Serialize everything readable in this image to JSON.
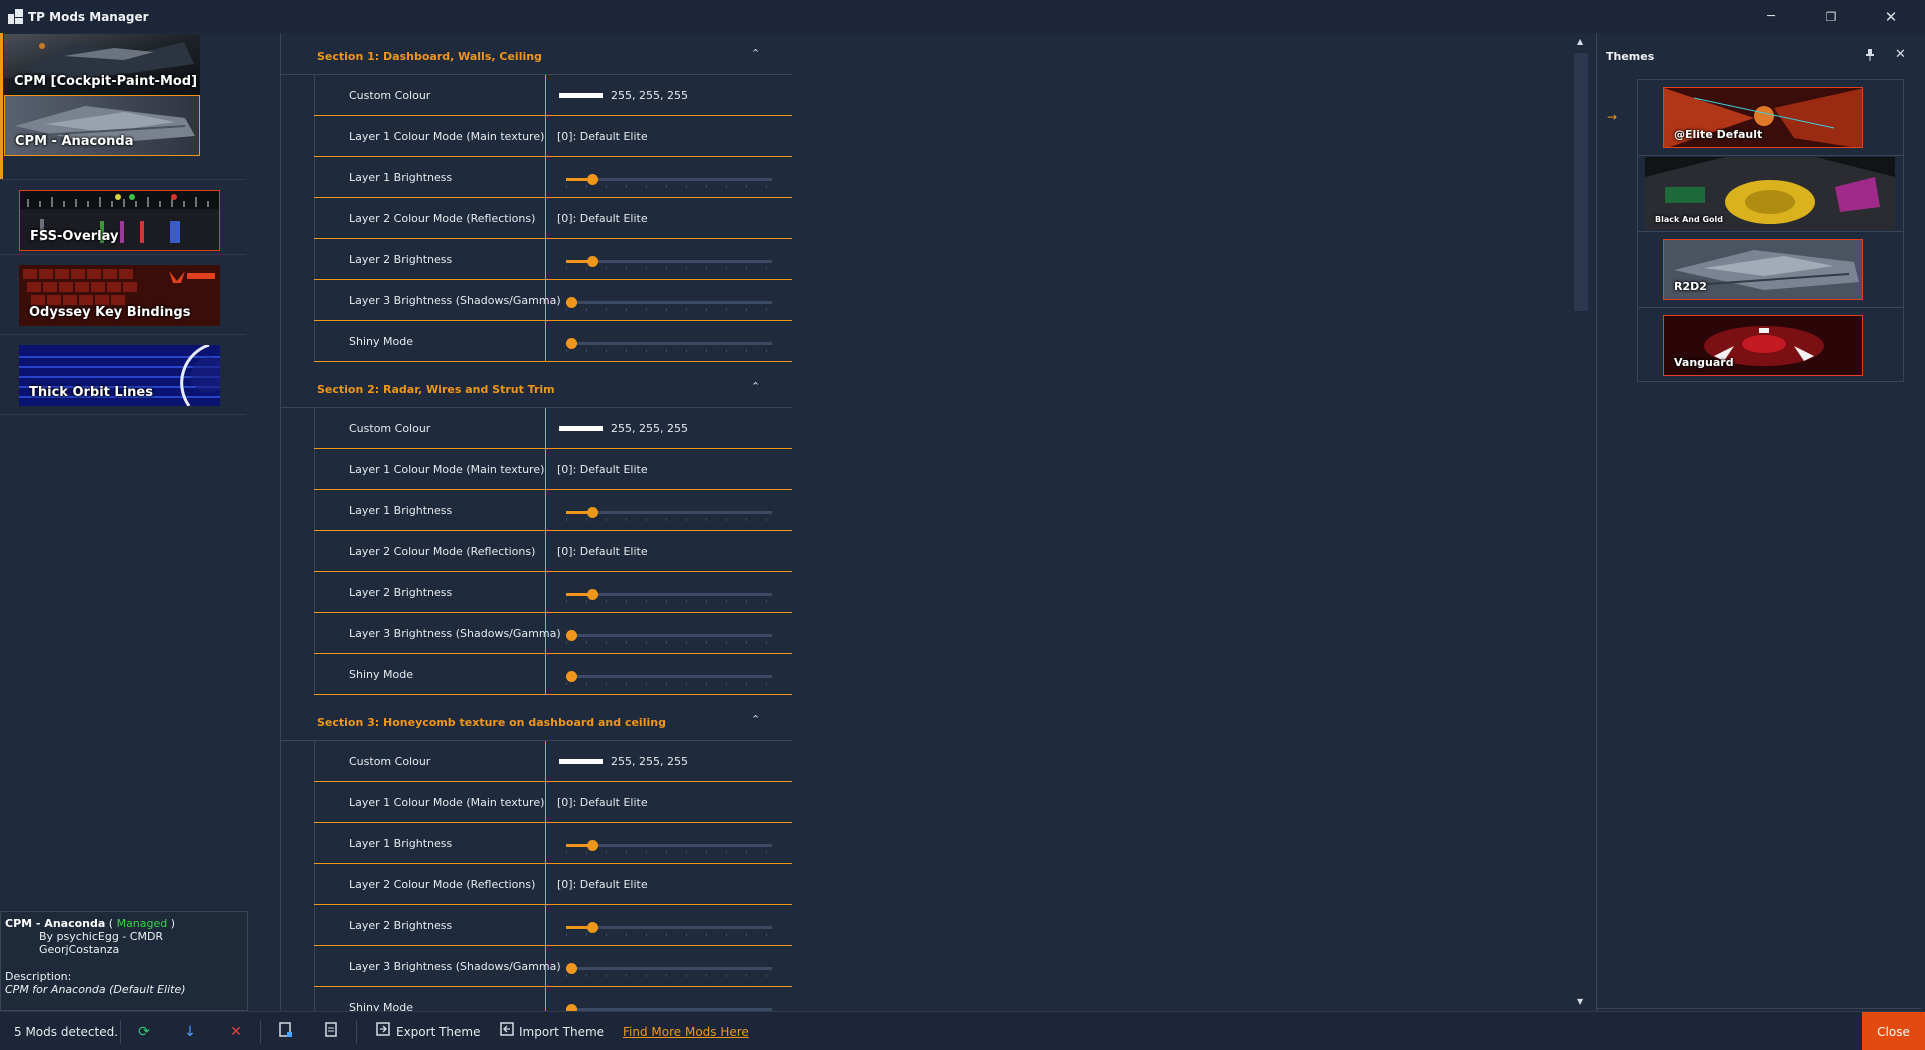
{
  "app": {
    "title": "TP Mods Manager"
  },
  "window_controls": {
    "minimize": "─",
    "restore": "❐",
    "close": "✕"
  },
  "mods": [
    {
      "label": "CPM [Cockpit-Paint-Mod]",
      "thumb": "cockpit"
    },
    {
      "label": "CPM - Anaconda",
      "thumb": "anaconda",
      "selected": true
    },
    {
      "label": "FSS-Overlay",
      "thumb": "fss"
    },
    {
      "label": "Odyssey Key Bindings",
      "thumb": "odyssey"
    },
    {
      "label": "Thick Orbit Lines",
      "thumb": "orbit"
    }
  ],
  "mod_info": {
    "name": "CPM - Anaconda",
    "open_paren": "(",
    "status": "Managed",
    "close_paren": ")",
    "author": "By psychicEgg - CMDR GeorjCostanza",
    "description_label": "Description:",
    "description": "CPM for Anaconda (Default Elite)"
  },
  "sections": [
    {
      "title": "Section 1: Dashboard, Walls, Ceiling",
      "rows": [
        {
          "label": "Custom Colour",
          "type": "colour",
          "value": "255, 255, 255"
        },
        {
          "label": "Layer 1 Colour Mode (Main texture)",
          "type": "text",
          "value": "[0]: Default Elite"
        },
        {
          "label": "Layer 1 Brightness",
          "type": "slider",
          "level": 0.1
        },
        {
          "label": "Layer 2 Colour Mode (Reflections)",
          "type": "text",
          "value": "[0]: Default Elite"
        },
        {
          "label": "Layer 2 Brightness",
          "type": "slider",
          "level": 0.1
        },
        {
          "label": "Layer 3 Brightness (Shadows/Gamma)",
          "type": "slider",
          "level": 0
        },
        {
          "label": "Shiny Mode",
          "type": "slider",
          "level": 0
        }
      ]
    },
    {
      "title": "Section 2: Radar, Wires and Strut Trim",
      "rows": [
        {
          "label": "Custom Colour",
          "type": "colour",
          "value": "255, 255, 255"
        },
        {
          "label": "Layer 1 Colour Mode (Main texture)",
          "type": "text",
          "value": "[0]: Default Elite"
        },
        {
          "label": "Layer 1 Brightness",
          "type": "slider",
          "level": 0.1
        },
        {
          "label": "Layer 2 Colour Mode (Reflections)",
          "type": "text",
          "value": "[0]: Default Elite"
        },
        {
          "label": "Layer 2 Brightness",
          "type": "slider",
          "level": 0.1
        },
        {
          "label": "Layer 3 Brightness (Shadows/Gamma)",
          "type": "slider",
          "level": 0
        },
        {
          "label": "Shiny Mode",
          "type": "slider",
          "level": 0
        }
      ]
    },
    {
      "title": "Section 3: Honeycomb texture on dashboard and ceiling",
      "rows": [
        {
          "label": "Custom Colour",
          "type": "colour",
          "value": "255, 255, 255"
        },
        {
          "label": "Layer 1 Colour Mode (Main texture)",
          "type": "text",
          "value": "[0]: Default Elite"
        },
        {
          "label": "Layer 1 Brightness",
          "type": "slider",
          "level": 0.1
        },
        {
          "label": "Layer 2 Colour Mode (Reflections)",
          "type": "text",
          "value": "[0]: Default Elite"
        },
        {
          "label": "Layer 2 Brightness",
          "type": "slider",
          "level": 0.1
        },
        {
          "label": "Layer 3 Brightness (Shadows/Gamma)",
          "type": "slider",
          "level": 0
        },
        {
          "label": "Shiny Mode",
          "type": "slider",
          "level": 0
        }
      ]
    }
  ],
  "themes_panel": {
    "title": "Themes",
    "pin": "📌",
    "close": "✕",
    "selected_arrow": "→",
    "items": [
      {
        "label": "@Elite Default",
        "thumb": "elite"
      },
      {
        "label": "Black And Gold",
        "thumb": "blackgold"
      },
      {
        "label": "R2D2",
        "thumb": "r2d2"
      },
      {
        "label": "Vanguard",
        "thumb": "vanguard"
      }
    ]
  },
  "bottom_bar": {
    "status": "5 Mods detected.",
    "export_label": "Export Theme",
    "import_label": "Import Theme",
    "find_link": "Find More Mods Here",
    "close_label": "Close"
  },
  "colors": {
    "accent": "#f0961a",
    "managed": "#3dd24a",
    "close_button": "#e34a10",
    "background": "#1f2a3c"
  }
}
